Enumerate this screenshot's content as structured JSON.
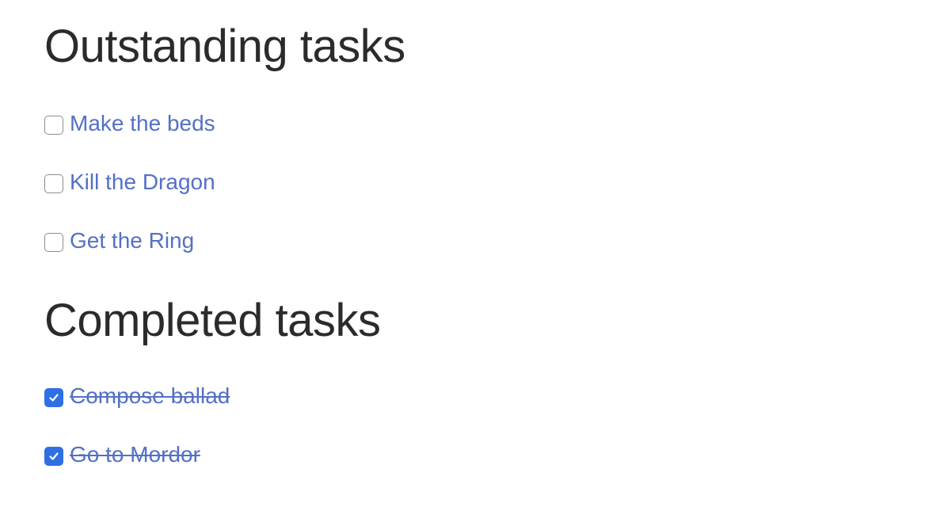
{
  "outstanding": {
    "title": "Outstanding tasks",
    "tasks": [
      {
        "label": "Make the beds",
        "checked": false
      },
      {
        "label": "Kill the Dragon",
        "checked": false
      },
      {
        "label": "Get the Ring",
        "checked": false
      }
    ]
  },
  "completed": {
    "title": "Completed tasks",
    "tasks": [
      {
        "label": "Compose ballad",
        "checked": true
      },
      {
        "label": "Go to Mordor",
        "checked": true
      }
    ]
  },
  "colors": {
    "link": "#5470c6",
    "checkbox_checked": "#2f6fe4",
    "heading": "#2b2b2b"
  },
  "icons": {
    "checked": "checkmark-icon"
  }
}
